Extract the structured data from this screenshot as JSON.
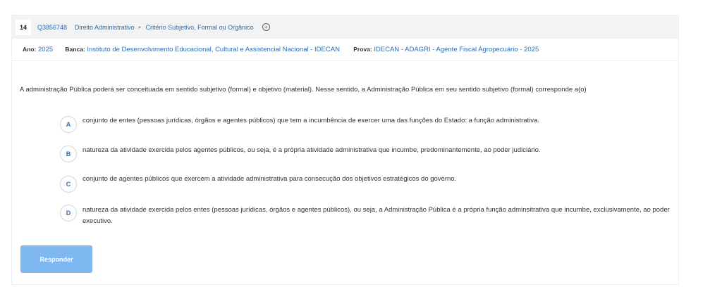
{
  "question": {
    "number": "14",
    "id": "Q3856748",
    "breadcrumb": [
      "Direito Administrativo",
      "Critério Subjetivo, Formal ou Orgânico"
    ],
    "add_icon": "plus-circle-icon"
  },
  "meta": {
    "ano_label": "Ano:",
    "ano_value": "2025",
    "banca_label": "Banca:",
    "banca_value": "Instituto de Desenvolvimento Educacional, Cultural e Assistencial Nacional - IDECAN",
    "prova_label": "Prova:",
    "prova_value": "IDECAN - ADAGRI - Agente Fiscal Agropecuário - 2025"
  },
  "statement": "A administração Pública poderá ser conceituada em sentido subjetivo (formal) e objetivo (material). Nesse sentido, a Administração Pública em seu sentido subjetivo (formal) corresponde a(o)",
  "options": [
    {
      "letter": "A",
      "text": "conjunto de entes (pessoas jurídicas, órgãos e agentes públicos) que tem a incumbência de exercer uma das funções do Estado: a função administrativa."
    },
    {
      "letter": "B",
      "text": "natureza da atividade exercida pelos agentes públicos, ou seja, é a própria atividade administrativa que incumbe, predominantemente, ao poder judiciário."
    },
    {
      "letter": "C",
      "text": "conjunto de agentes públicos que exercem a atividade administrativa para consecução dos objetivos estratégicos do governo."
    },
    {
      "letter": "D",
      "text": "natureza da atividade exercida pelos entes (pessoas jurídicas, órgãos e agentes públicos), ou seja, a Administração Pública é a própria função adminsitrativa que incumbe, exclusivamente, ao poder executivo."
    }
  ],
  "submit_label": "Responder",
  "colors": {
    "accent": "#2c6db0",
    "button": "#7fb7f0",
    "header_bg": "#f1f3f5"
  }
}
